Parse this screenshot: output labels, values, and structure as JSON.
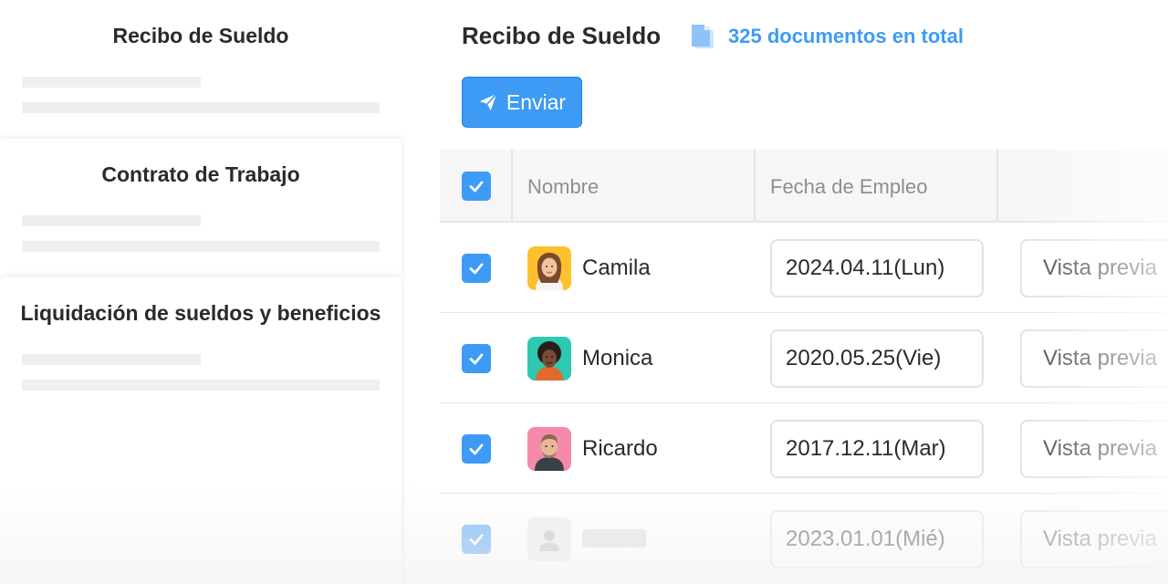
{
  "sidebar": {
    "documents": [
      {
        "title": "Recibo de Sueldo"
      },
      {
        "title": "Contrato de Trabajo"
      },
      {
        "title": "Liquidación de sueldos y beneficios"
      }
    ]
  },
  "header": {
    "title": "Recibo de Sueldo",
    "count_text": "325 documentos en total",
    "icon": "document-icon"
  },
  "toolbar": {
    "send_label": "Enviar",
    "send_icon": "paper-plane-icon"
  },
  "table": {
    "columns": [
      "Nombre",
      "Fecha de Empleo"
    ],
    "rows": [
      {
        "name": "Camila",
        "date": "2024.04.11(Lun)",
        "preview": "Vista previa",
        "checked": true
      },
      {
        "name": "Monica",
        "date": "2020.05.25(Vie)",
        "preview": "Vista previa",
        "checked": true
      },
      {
        "name": "Ricardo",
        "date": "2017.12.11(Mar)",
        "preview": "Vista previa",
        "checked": true
      },
      {
        "name": "",
        "date": "2023.01.01(Mié)",
        "preview": "Vista previa",
        "checked": true
      }
    ]
  },
  "colors": {
    "accent": "#3d9bf5",
    "avatar_camila": "#ffc02e",
    "avatar_monica": "#2ec9b0",
    "avatar_ricardo": "#f58aa8"
  }
}
